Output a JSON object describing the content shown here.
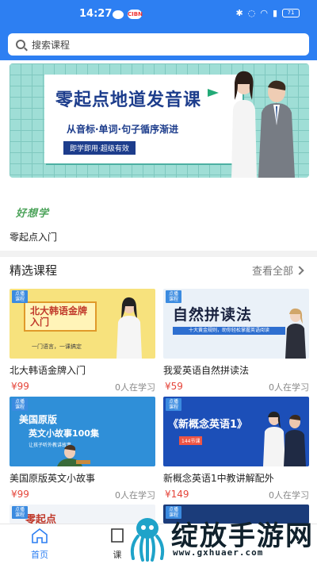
{
  "status_bar": {
    "time": "14:27",
    "notif_badge": "CIBN",
    "battery": "71",
    "icons": [
      "chat-icon",
      "bluetooth-icon",
      "mute-icon",
      "wifi-icon",
      "signal-icon",
      "battery-icon"
    ]
  },
  "search": {
    "placeholder": "搜索课程"
  },
  "banner": {
    "title": "零起点地道发音课",
    "subtitle": "从音标·单词·句子循序渐进",
    "tag": "即学即用·超级有效"
  },
  "brand": {
    "logo_text": "好想学"
  },
  "quick_entry": {
    "label": "零起点入门"
  },
  "section": {
    "title": "精选课程",
    "more": "查看全部"
  },
  "courses": [
    {
      "name": "北大韩语金牌入门",
      "price": "¥99",
      "learners": "0人在学习",
      "thumb": {
        "tag": "点播课程",
        "title": "北大韩语金牌入门",
        "foot": "一门语言，一课搞定"
      }
    },
    {
      "name": "我爱英语自然拼读法",
      "price": "¥59",
      "learners": "0人在学习",
      "thumb": {
        "tag": "点播课程",
        "title": "自然拼读法",
        "bar": "十大黄金规则，助你轻松掌握英语阅读"
      }
    },
    {
      "name": "美国原版英文小故事",
      "price": "¥99",
      "learners": "0人在学习",
      "thumb": {
        "tag": "点播课程",
        "line1": "美国原版",
        "line2": "英文小故事100集",
        "line3": "让孩子听外教讲故事"
      }
    },
    {
      "name": "新概念英语1中教讲解配外",
      "price": "¥149",
      "learners": "0人在学习",
      "thumb": {
        "tag": "点播课程",
        "title": "《新概念英语1》",
        "badge": "144节课"
      }
    },
    {
      "thumb": {
        "tag": "点播课程",
        "title": "零起点"
      }
    },
    {
      "thumb": {
        "tag": "点播课程"
      }
    }
  ],
  "bottom_nav": {
    "items": [
      {
        "label": "首页",
        "active": true
      },
      {
        "label": "课"
      }
    ]
  },
  "watermark": {
    "text": "绽放手游网",
    "url": "www.gxhuaer.com"
  },
  "colors": {
    "primary": "#2d7ff2",
    "price": "#e5453a",
    "banner_bg": "#9fded6"
  }
}
